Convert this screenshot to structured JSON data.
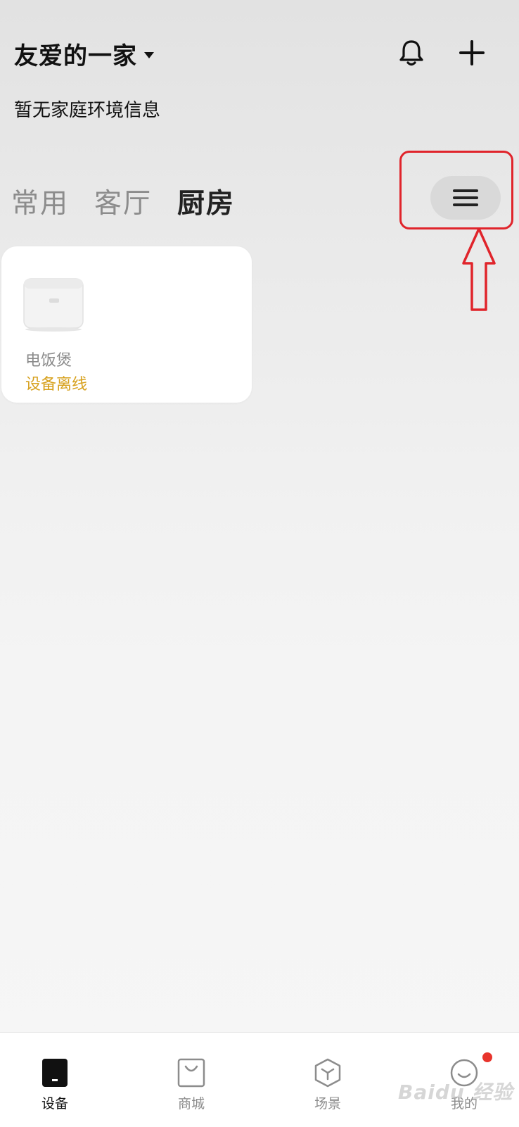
{
  "header": {
    "home_name": "友爱的一家",
    "env_info": "暂无家庭环境信息"
  },
  "icons": {
    "bell": "bell-icon",
    "add": "plus-icon",
    "menu": "hamburger-menu-icon",
    "up_arrow": "up-arrow-annotation"
  },
  "room_tabs": [
    {
      "label": "常用",
      "active": false
    },
    {
      "label": "客厅",
      "active": false
    },
    {
      "label": "厨房",
      "active": true
    }
  ],
  "devices": [
    {
      "name": "电饭煲",
      "status": "设备离线",
      "icon": "rice-cooker-image"
    }
  ],
  "bottom_nav": [
    {
      "label": "设备",
      "icon": "device-icon",
      "active": true
    },
    {
      "label": "商城",
      "icon": "shopping-bag-icon",
      "active": false
    },
    {
      "label": "场景",
      "icon": "cube-icon",
      "active": false
    },
    {
      "label": "我的",
      "icon": "smile-face-icon",
      "active": false,
      "badge": true
    }
  ],
  "watermark": "Baidu 经验",
  "colors": {
    "accent_status": "#d7a11e",
    "annotation_red": "#e0242b",
    "badge_red": "#e8342c",
    "text_primary": "#111111",
    "text_muted": "#8c8c8c"
  }
}
